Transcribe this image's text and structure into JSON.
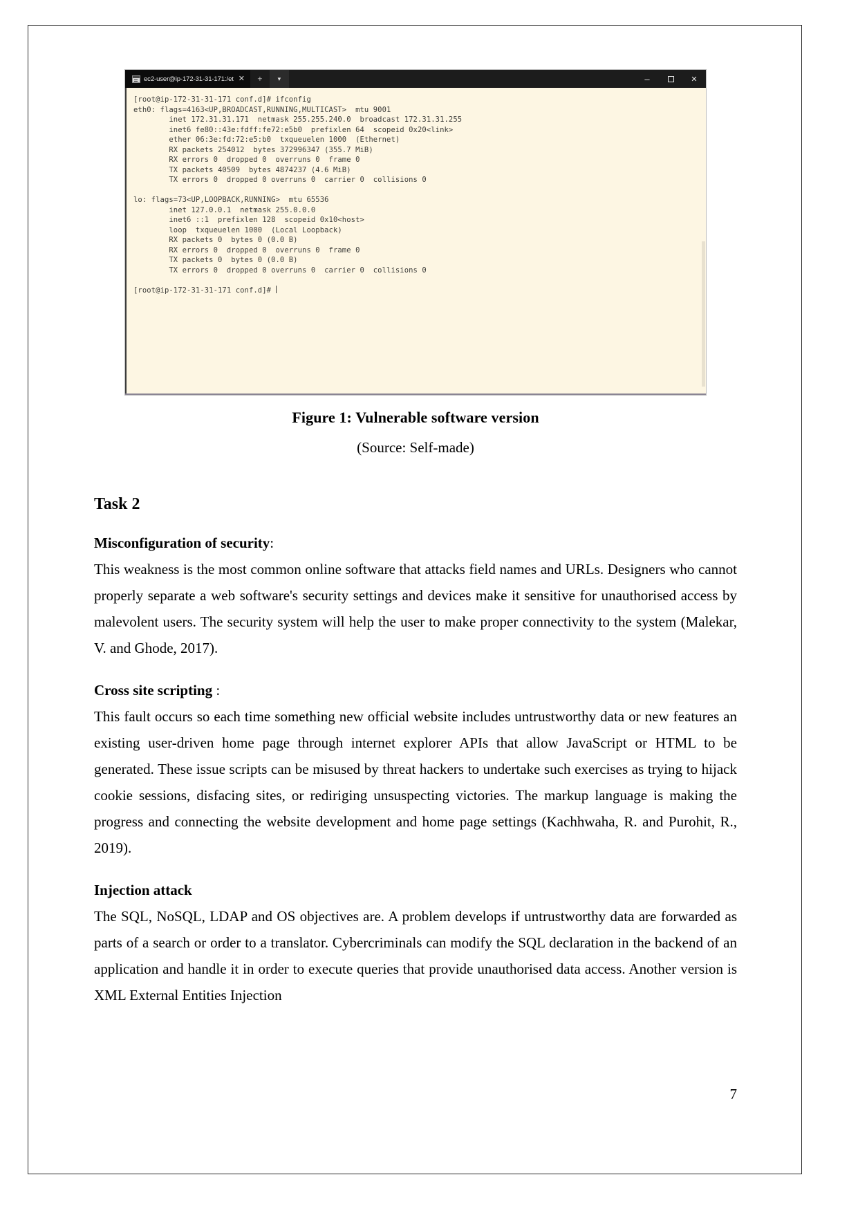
{
  "document": {
    "page_number": "7"
  },
  "figure": {
    "terminal": {
      "tab_title": "ec2-user@ip-172-31-31-171:/et",
      "tab_close_icon": "close-icon",
      "new_tab_icon": "plus-icon",
      "dropdown_icon": "chevron-down-icon",
      "minimize_icon": "minimize-icon",
      "maximize_icon": "maximize-icon",
      "close_window_icon": "close-icon",
      "lines": [
        "[root@ip-172-31-31-171 conf.d]# ifconfig",
        "eth0: flags=4163<UP,BROADCAST,RUNNING,MULTICAST>  mtu 9001",
        "        inet 172.31.31.171  netmask 255.255.240.0  broadcast 172.31.31.255",
        "        inet6 fe80::43e:fdff:fe72:e5b0  prefixlen 64  scopeid 0x20<link>",
        "        ether 06:3e:fd:72:e5:b0  txqueuelen 1000  (Ethernet)",
        "        RX packets 254012  bytes 372996347 (355.7 MiB)",
        "        RX errors 0  dropped 0  overruns 0  frame 0",
        "        TX packets 40509  bytes 4874237 (4.6 MiB)",
        "        TX errors 0  dropped 0 overruns 0  carrier 0  collisions 0",
        "",
        "lo: flags=73<UP,LOOPBACK,RUNNING>  mtu 65536",
        "        inet 127.0.0.1  netmask 255.0.0.0",
        "        inet6 ::1  prefixlen 128  scopeid 0x10<host>",
        "        loop  txqueuelen 1000  (Local Loopback)",
        "        RX packets 0  bytes 0 (0.0 B)",
        "        RX errors 0  dropped 0  overruns 0  frame 0",
        "        TX packets 0  bytes 0 (0.0 B)",
        "        TX errors 0  dropped 0 overruns 0  carrier 0  collisions 0",
        "",
        "[root@ip-172-31-31-171 conf.d]# "
      ],
      "colors": {
        "background": "#fdf6e3",
        "text": "#3b3b38",
        "titlebar": "#1c1c1c",
        "tab_active": "#0c0c0c"
      }
    },
    "caption": "Figure 1: Vulnerable software version",
    "source": "(Source: Self-made)"
  },
  "content": {
    "task_heading": "Task 2",
    "sections": [
      {
        "heading": "Misconfiguration of security",
        "heading_suffix": ":",
        "body": "This weakness is the most common online software that attacks field names and URLs. Designers who cannot properly separate a web software's security settings and devices make it sensitive for unauthorised access by malevolent users. The security system will help the user to make proper connectivity to the system (Malekar, V. and Ghode, 2017)."
      },
      {
        "heading": "Cross site scripting",
        "heading_suffix": " :",
        "body": "This fault occurs so each time something new official website includes untrustworthy data or new features an existing user-driven home page through internet explorer APIs that allow JavaScript or HTML to be generated. These issue scripts can be misused by threat hackers to undertake such exercises as trying to hijack cookie sessions, disfacing sites, or rediriging unsuspecting victories. The markup language is making the progress and connecting the website development and home page settings (Kachhwaha, R. and Purohit, R., 2019)."
      },
      {
        "heading": "Injection attack",
        "heading_suffix": "",
        "body": "The SQL, NoSQL, LDAP and OS objectives are. A problem develops if untrustworthy data are forwarded as parts of a search or order to a translator. Cybercriminals can modify the SQL declaration in the backend of an application and handle it in order to execute queries that provide unauthorised data access. Another version is XML External Entities Injection"
      }
    ]
  }
}
